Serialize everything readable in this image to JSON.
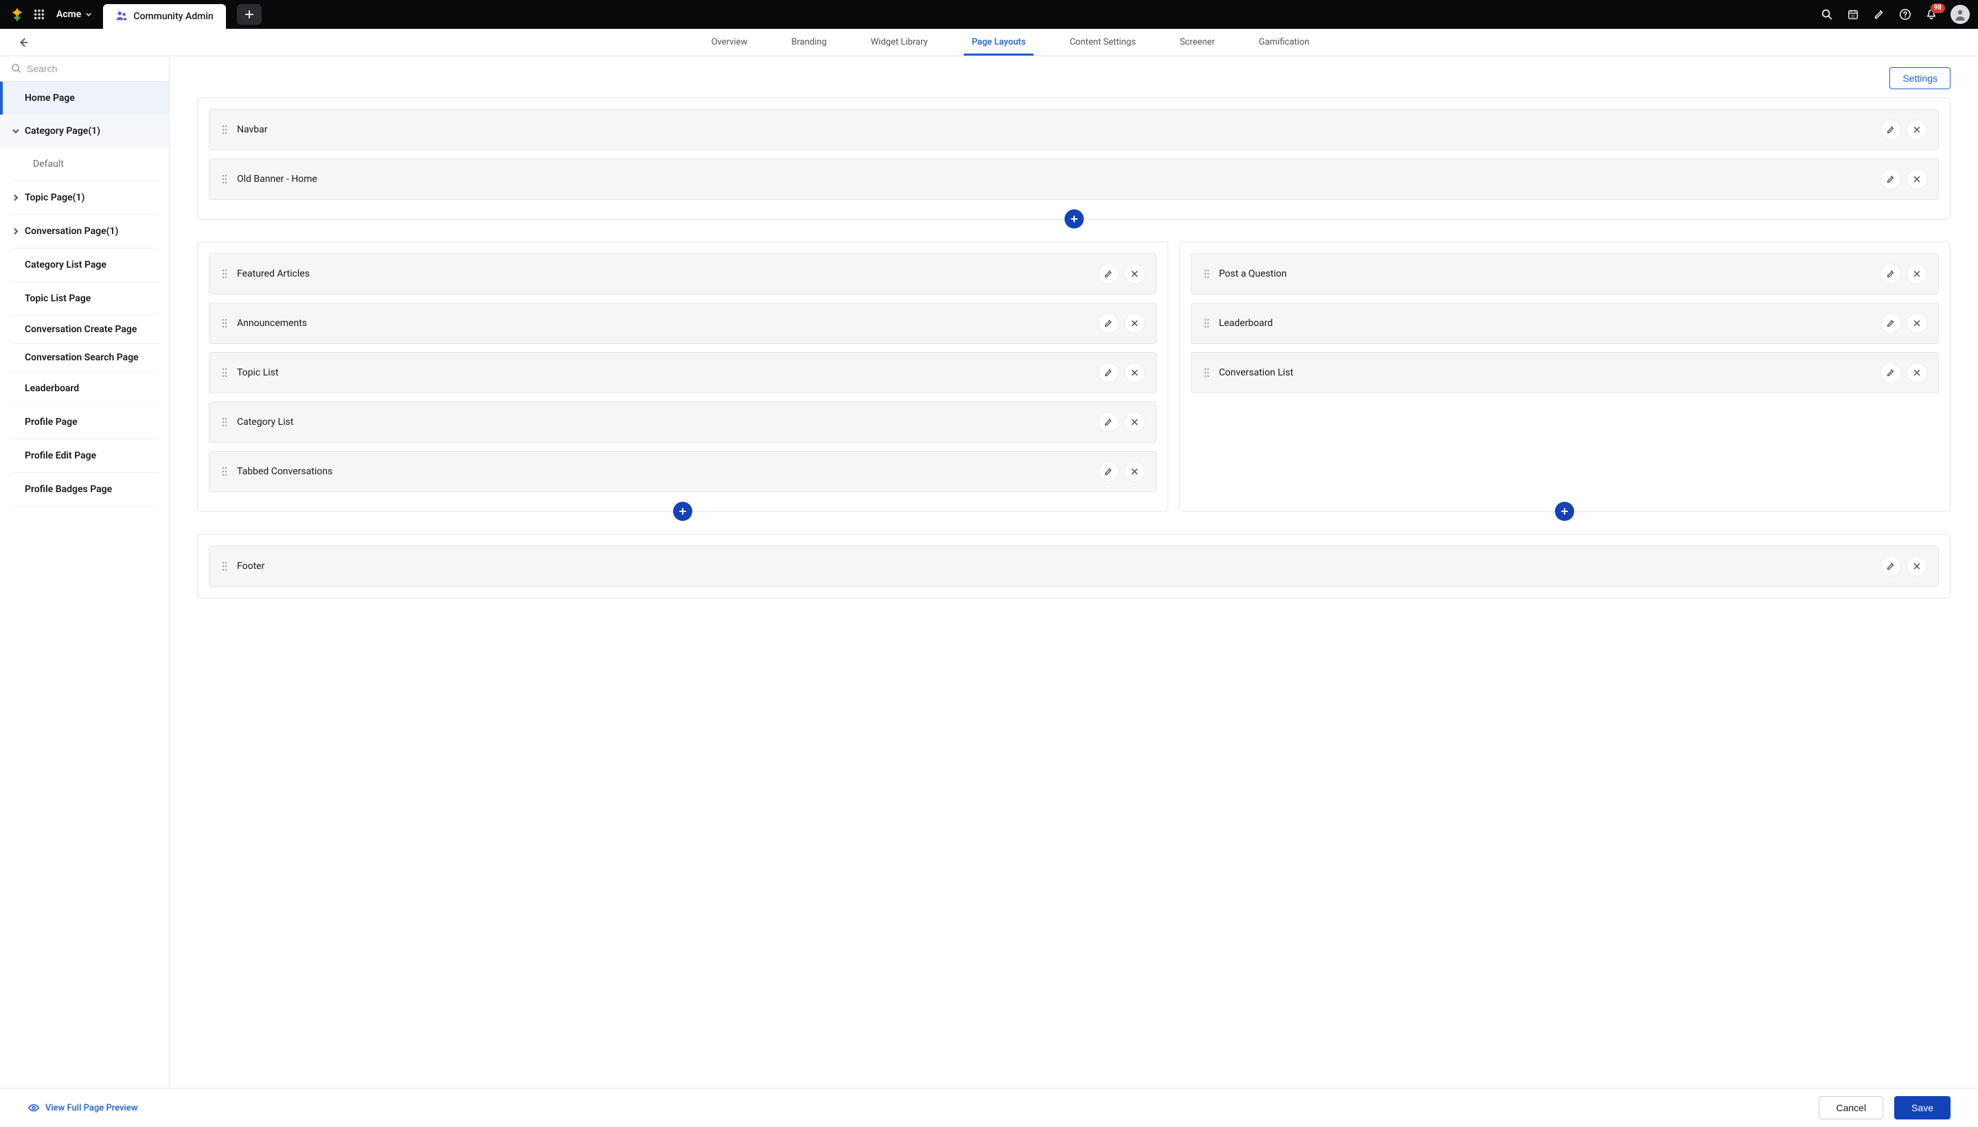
{
  "topbar": {
    "org_name": "Acme",
    "app_tab_label": "Community Admin",
    "notifications_count": "98"
  },
  "subnav": {
    "tabs": [
      {
        "label": "Overview",
        "active": false
      },
      {
        "label": "Branding",
        "active": false
      },
      {
        "label": "Widget Library",
        "active": false
      },
      {
        "label": "Page Layouts",
        "active": true
      },
      {
        "label": "Content Settings",
        "active": false
      },
      {
        "label": "Screener",
        "active": false
      },
      {
        "label": "Gamification",
        "active": false
      }
    ]
  },
  "sidebar": {
    "search_placeholder": "Search",
    "pages": {
      "home": "Home Page",
      "category": "Category Page(1)",
      "category_child": "Default",
      "topic": "Topic Page(1)",
      "conversation": "Conversation Page(1)",
      "category_list": "Category List Page",
      "topic_list": "Topic List Page",
      "conversation_create": "Conversation Create Page",
      "conversation_search": "Conversation Search Page",
      "leaderboard": "Leaderboard",
      "profile": "Profile Page",
      "profile_edit": "Profile Edit Page",
      "profile_badges": "Profile Badges Page"
    }
  },
  "canvas": {
    "settings_button": "Settings",
    "header_section": [
      {
        "name": "Navbar"
      },
      {
        "name": "Old Banner - Home"
      }
    ],
    "left_column": [
      {
        "name": "Featured Articles"
      },
      {
        "name": "Announcements"
      },
      {
        "name": "Topic List"
      },
      {
        "name": "Category List"
      },
      {
        "name": "Tabbed Conversations"
      }
    ],
    "right_column": [
      {
        "name": "Post a Question"
      },
      {
        "name": "Leaderboard"
      },
      {
        "name": "Conversation List"
      }
    ],
    "footer_section": [
      {
        "name": "Footer"
      }
    ]
  },
  "bottombar": {
    "preview_label": "View Full Page Preview",
    "cancel": "Cancel",
    "save": "Save"
  }
}
